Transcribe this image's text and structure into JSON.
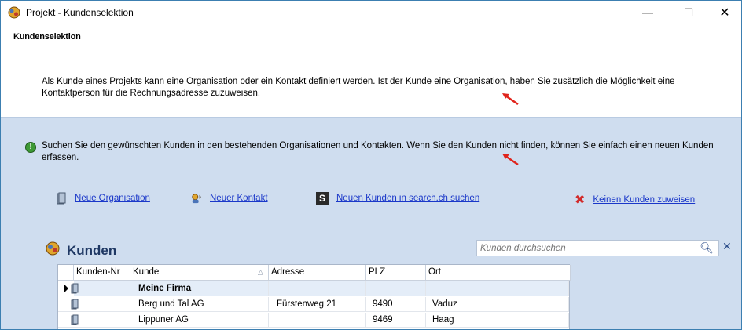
{
  "window": {
    "title": "Projekt - Kundenselektion",
    "controls": {
      "minimize": "—",
      "maximize": "☐",
      "close": "✕"
    }
  },
  "header": {
    "section_title": "Kundenselektion",
    "intro": "Als Kunde eines Projekts kann eine Organisation oder ein Kontakt definiert werden. Ist der Kunde eine Organisation, haben Sie zusätzlich die Möglichkeit eine Kontaktperson für die Rechnungsadresse zuzuweisen."
  },
  "hint": "Suchen Sie den gewünschten Kunden in den bestehenden Organisationen und Kontakten. Wenn Sie den Kunden nicht finden, können Sie einfach einen neuen Kunden erfassen.",
  "actions": {
    "new_org": "Neue Organisation",
    "new_contact": "Neuer Kontakt",
    "search_ch": "Neuen Kunden in search.ch suchen",
    "no_customer": "Keinen Kunden zuweisen"
  },
  "panel": {
    "title": "Kunden",
    "search_placeholder": "Kunden durchsuchen"
  },
  "grid": {
    "columns": [
      "Kunden-Nr",
      "Kunde",
      "Adresse",
      "PLZ",
      "Ort"
    ],
    "sort_indicator": "△",
    "rows": [
      {
        "nr": "",
        "kunde": "Meine Firma",
        "adresse": "",
        "plz": "",
        "ort": "",
        "selected": true,
        "bold": true
      },
      {
        "nr": "",
        "kunde": "Berg und Tal AG",
        "adresse": "Fürstenweg 21",
        "plz": "9490",
        "ort": "Vaduz",
        "selected": false,
        "bold": false
      },
      {
        "nr": "",
        "kunde": "Lippuner AG",
        "adresse": "",
        "plz": "9469",
        "ort": "Haag",
        "selected": false,
        "bold": false
      }
    ]
  },
  "colors": {
    "link": "#1a37c9",
    "panel_bg": "#cfddef",
    "title_blue": "#1f3864",
    "annotation_red": "#e0241c"
  },
  "icons": [
    "app-icon",
    "info-icon",
    "organisation-icon",
    "contact-icon",
    "search-ch-icon",
    "remove-icon",
    "search-icon",
    "clear-icon",
    "row-pointer-icon"
  ]
}
